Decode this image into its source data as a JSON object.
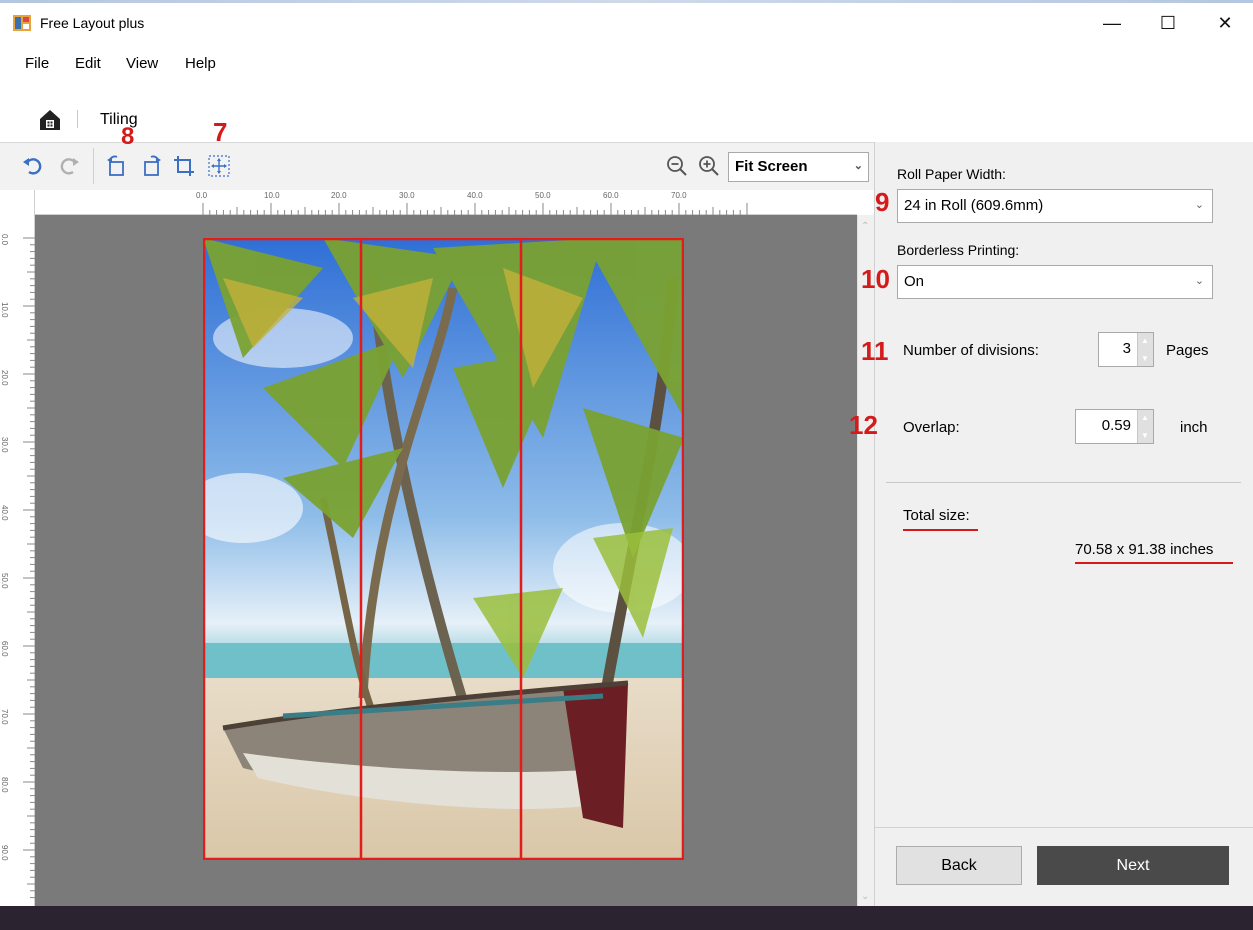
{
  "window": {
    "title": "Free Layout plus",
    "controls": {
      "minimize": "—",
      "maximize": "☐",
      "close": "✕"
    }
  },
  "menu": {
    "items": [
      "File",
      "Edit",
      "View",
      "Help"
    ]
  },
  "breadcrumb": {
    "current": "Tiling"
  },
  "toolbar": {
    "zoom": {
      "selected": "Fit Screen"
    },
    "icons": [
      "undo-icon",
      "redo-icon",
      "rotate-left-icon",
      "rotate-right-icon",
      "crop-icon",
      "fit-image-icon",
      "zoom-out-icon",
      "zoom-in-icon"
    ]
  },
  "annotations": {
    "fit_image": "7",
    "rotate": "8",
    "roll_width": "9",
    "borderless": "10",
    "divisions": "11",
    "overlap": "12"
  },
  "ruler": {
    "top": [
      "0.0",
      "10.0",
      "20.0",
      "30.0",
      "40.0",
      "50.0",
      "60.0",
      "70.0"
    ],
    "left": [
      "0.0",
      "10.0",
      "20.0",
      "30.0",
      "40.0",
      "50.0",
      "60.0",
      "70.0",
      "80.0",
      "90.0"
    ]
  },
  "panel": {
    "roll_width": {
      "label": "Roll Paper Width:",
      "value": "24 in Roll (609.6mm)"
    },
    "borderless": {
      "label": "Borderless Printing:",
      "value": "On"
    },
    "divisions": {
      "label": "Number of divisions:",
      "value": "3",
      "unit": "Pages"
    },
    "overlap": {
      "label": "Overlap:",
      "value": "0.59",
      "unit": "inch"
    },
    "total": {
      "label": "Total size:",
      "value": "70.58 x 91.38 inches"
    },
    "back_label": "Back",
    "next_label": "Next"
  },
  "colors": {
    "accent_red": "#d41a1a",
    "next_button": "#4a4a4a",
    "canvas_bg": "#7a7a7a"
  }
}
